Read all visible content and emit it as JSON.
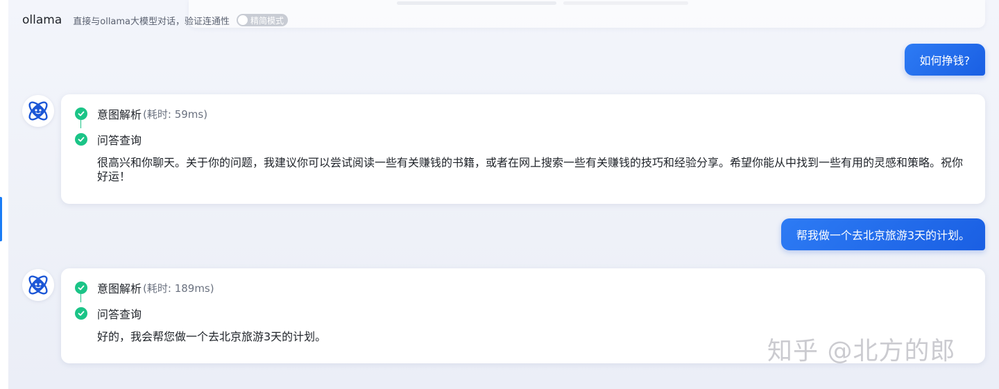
{
  "header": {
    "title": "ollama",
    "subtitle": "直接与ollama大模型对话，验证连通性",
    "toggle_label": "精简模式"
  },
  "conversation": [
    {
      "user_message": "如何挣钱?",
      "steps": [
        {
          "label": "意图解析",
          "meta": "(耗时: 59ms)"
        },
        {
          "label": "问答查询",
          "meta": ""
        }
      ],
      "answer": "很高兴和你聊天。关于你的问题，我建议你可以尝试阅读一些有关赚钱的书籍，或者在网上搜索一些有关赚钱的技巧和经验分享。希望你能从中找到一些有用的灵感和策略。祝你好运！"
    },
    {
      "user_message": "帮我做一个去北京旅游3天的计划。",
      "steps": [
        {
          "label": "意图解析",
          "meta": "(耗时: 189ms)"
        },
        {
          "label": "问答查询",
          "meta": ""
        }
      ],
      "answer": "好的，我会帮您做一个去北京旅游3天的计划。"
    }
  ],
  "watermark": "知乎 @北方的郎",
  "icons": {
    "avatar": "robot-atom-icon",
    "step_status": "check-circle-icon"
  },
  "colors": {
    "accent": "#2d7bf4",
    "success": "#1bc487",
    "rail_marker": "#1a7cf5"
  }
}
